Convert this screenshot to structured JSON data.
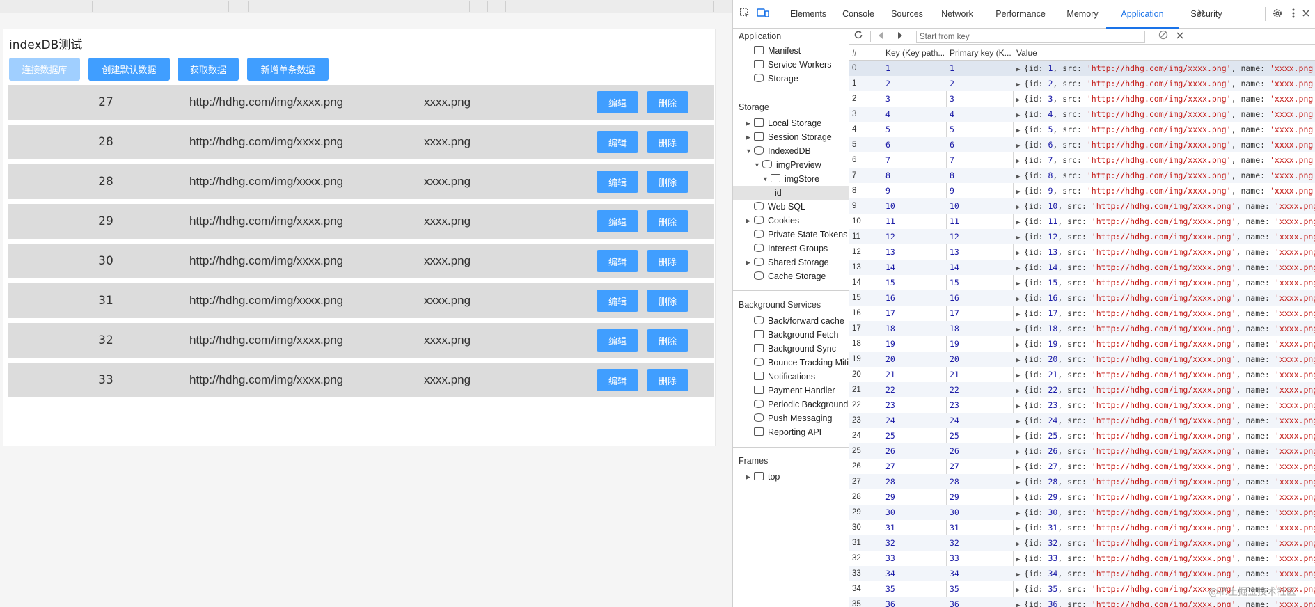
{
  "app": {
    "title": "indexDB测试",
    "buttons": {
      "connect": "连接数据库",
      "create_default": "创建默认数据",
      "get_data": "获取数据",
      "add_single": "新增单条数据"
    },
    "row_edit_label": "编辑",
    "row_delete_label": "删除",
    "rows": [
      {
        "id": "27",
        "src": "http://hdhg.com/img/xxxx.png",
        "name": "xxxx.png"
      },
      {
        "id": "28",
        "src": "http://hdhg.com/img/xxxx.png",
        "name": "xxxx.png"
      },
      {
        "id": "28",
        "src": "http://hdhg.com/img/xxxx.png",
        "name": "xxxx.png"
      },
      {
        "id": "29",
        "src": "http://hdhg.com/img/xxxx.png",
        "name": "xxxx.png"
      },
      {
        "id": "30",
        "src": "http://hdhg.com/img/xxxx.png",
        "name": "xxxx.png"
      },
      {
        "id": "31",
        "src": "http://hdhg.com/img/xxxx.png",
        "name": "xxxx.png"
      },
      {
        "id": "32",
        "src": "http://hdhg.com/img/xxxx.png",
        "name": "xxxx.png"
      },
      {
        "id": "33",
        "src": "http://hdhg.com/img/xxxx.png",
        "name": "xxxx.png"
      }
    ],
    "accent_color": "#409eff"
  },
  "devtools": {
    "tabs": [
      "Elements",
      "Console",
      "Sources",
      "Network",
      "Performance",
      "Memory",
      "Application",
      "Security"
    ],
    "active_tab": "Application",
    "more_tabs_icon": "chevron-double-right-icon",
    "sidebar": {
      "application_header": "Application",
      "application_items": [
        "Manifest",
        "Service Workers",
        "Storage"
      ],
      "storage_header": "Storage",
      "storage_items": [
        "Local Storage",
        "Session Storage",
        "IndexedDB",
        "imgPreview",
        "imgStore",
        "id",
        "Web SQL",
        "Cookies",
        "Private State Tokens",
        "Interest Groups",
        "Shared Storage",
        "Cache Storage"
      ],
      "background_header": "Background Services",
      "background_items": [
        "Back/forward cache",
        "Background Fetch",
        "Background Sync",
        "Bounce Tracking Mitig",
        "Notifications",
        "Payment Handler",
        "Periodic Background S",
        "Push Messaging",
        "Reporting API"
      ],
      "frames_header": "Frames",
      "frames_items": [
        "top"
      ]
    },
    "key_placeholder": "Start from key",
    "columns": [
      "#",
      "Key (Key path...",
      "Primary key (K...",
      "Value"
    ],
    "records": [
      {
        "idx": "0",
        "key": "1",
        "pk": "1",
        "val_id": "1",
        "val_src": "'http://hdhg.com/img/xxxx.png'",
        "val_name": "'xxxx.png'"
      },
      {
        "idx": "1",
        "key": "2",
        "pk": "2",
        "val_id": "2",
        "val_src": "'http://hdhg.com/img/xxxx.png'",
        "val_name": "'xxxx.png'"
      },
      {
        "idx": "2",
        "key": "3",
        "pk": "3",
        "val_id": "3",
        "val_src": "'http://hdhg.com/img/xxxx.png'",
        "val_name": "'xxxx.png'"
      },
      {
        "idx": "3",
        "key": "4",
        "pk": "4",
        "val_id": "4",
        "val_src": "'http://hdhg.com/img/xxxx.png'",
        "val_name": "'xxxx.png'"
      },
      {
        "idx": "4",
        "key": "5",
        "pk": "5",
        "val_id": "5",
        "val_src": "'http://hdhg.com/img/xxxx.png'",
        "val_name": "'xxxx.png'"
      },
      {
        "idx": "5",
        "key": "6",
        "pk": "6",
        "val_id": "6",
        "val_src": "'http://hdhg.com/img/xxxx.png'",
        "val_name": "'xxxx.png'"
      },
      {
        "idx": "6",
        "key": "7",
        "pk": "7",
        "val_id": "7",
        "val_src": "'http://hdhg.com/img/xxxx.png'",
        "val_name": "'xxxx.png'"
      },
      {
        "idx": "7",
        "key": "8",
        "pk": "8",
        "val_id": "8",
        "val_src": "'http://hdhg.com/img/xxxx.png'",
        "val_name": "'xxxx.png'"
      },
      {
        "idx": "8",
        "key": "9",
        "pk": "9",
        "val_id": "9",
        "val_src": "'http://hdhg.com/img/xxxx.png'",
        "val_name": "'xxxx.png'"
      },
      {
        "idx": "9",
        "key": "10",
        "pk": "10",
        "val_id": "10",
        "val_src": "'http://hdhg.com/img/xxxx.png'",
        "val_name": "'xxxx.png"
      },
      {
        "idx": "10",
        "key": "11",
        "pk": "11",
        "val_id": "11",
        "val_src": "'http://hdhg.com/img/xxxx.png'",
        "val_name": "'xxxx.png"
      },
      {
        "idx": "11",
        "key": "12",
        "pk": "12",
        "val_id": "12",
        "val_src": "'http://hdhg.com/img/xxxx.png'",
        "val_name": "'xxxx.png"
      },
      {
        "idx": "12",
        "key": "13",
        "pk": "13",
        "val_id": "13",
        "val_src": "'http://hdhg.com/img/xxxx.png'",
        "val_name": "'xxxx.png"
      },
      {
        "idx": "13",
        "key": "14",
        "pk": "14",
        "val_id": "14",
        "val_src": "'http://hdhg.com/img/xxxx.png'",
        "val_name": "'xxxx.png"
      },
      {
        "idx": "14",
        "key": "15",
        "pk": "15",
        "val_id": "15",
        "val_src": "'http://hdhg.com/img/xxxx.png'",
        "val_name": "'xxxx.png"
      },
      {
        "idx": "15",
        "key": "16",
        "pk": "16",
        "val_id": "16",
        "val_src": "'http://hdhg.com/img/xxxx.png'",
        "val_name": "'xxxx.png"
      },
      {
        "idx": "16",
        "key": "17",
        "pk": "17",
        "val_id": "17",
        "val_src": "'http://hdhg.com/img/xxxx.png'",
        "val_name": "'xxxx.png"
      },
      {
        "idx": "17",
        "key": "18",
        "pk": "18",
        "val_id": "18",
        "val_src": "'http://hdhg.com/img/xxxx.png'",
        "val_name": "'xxxx.png"
      },
      {
        "idx": "18",
        "key": "19",
        "pk": "19",
        "val_id": "19",
        "val_src": "'http://hdhg.com/img/xxxx.png'",
        "val_name": "'xxxx.png"
      },
      {
        "idx": "19",
        "key": "20",
        "pk": "20",
        "val_id": "20",
        "val_src": "'http://hdhg.com/img/xxxx.png'",
        "val_name": "'xxxx.png"
      },
      {
        "idx": "20",
        "key": "21",
        "pk": "21",
        "val_id": "21",
        "val_src": "'http://hdhg.com/img/xxxx.png'",
        "val_name": "'xxxx.png"
      },
      {
        "idx": "21",
        "key": "22",
        "pk": "22",
        "val_id": "22",
        "val_src": "'http://hdhg.com/img/xxxx.png'",
        "val_name": "'xxxx.png"
      },
      {
        "idx": "22",
        "key": "23",
        "pk": "23",
        "val_id": "23",
        "val_src": "'http://hdhg.com/img/xxxx.png'",
        "val_name": "'xxxx.png"
      },
      {
        "idx": "23",
        "key": "24",
        "pk": "24",
        "val_id": "24",
        "val_src": "'http://hdhg.com/img/xxxx.png'",
        "val_name": "'xxxx.png"
      },
      {
        "idx": "24",
        "key": "25",
        "pk": "25",
        "val_id": "25",
        "val_src": "'http://hdhg.com/img/xxxx.png'",
        "val_name": "'xxxx.png"
      },
      {
        "idx": "25",
        "key": "26",
        "pk": "26",
        "val_id": "26",
        "val_src": "'http://hdhg.com/img/xxxx.png'",
        "val_name": "'xxxx.png"
      },
      {
        "idx": "26",
        "key": "27",
        "pk": "27",
        "val_id": "27",
        "val_src": "'http://hdhg.com/img/xxxx.png'",
        "val_name": "'xxxx.png"
      },
      {
        "idx": "27",
        "key": "28",
        "pk": "28",
        "val_id": "28",
        "val_src": "'http://hdhg.com/img/xxxx.png'",
        "val_name": "'xxxx.png"
      },
      {
        "idx": "28",
        "key": "29",
        "pk": "29",
        "val_id": "29",
        "val_src": "'http://hdhg.com/img/xxxx.png'",
        "val_name": "'xxxx.png"
      },
      {
        "idx": "29",
        "key": "30",
        "pk": "30",
        "val_id": "30",
        "val_src": "'http://hdhg.com/img/xxxx.png'",
        "val_name": "'xxxx.png"
      },
      {
        "idx": "30",
        "key": "31",
        "pk": "31",
        "val_id": "31",
        "val_src": "'http://hdhg.com/img/xxxx.png'",
        "val_name": "'xxxx.png"
      },
      {
        "idx": "31",
        "key": "32",
        "pk": "32",
        "val_id": "32",
        "val_src": "'http://hdhg.com/img/xxxx.png'",
        "val_name": "'xxxx.png"
      },
      {
        "idx": "32",
        "key": "33",
        "pk": "33",
        "val_id": "33",
        "val_src": "'http://hdhg.com/img/xxxx.png'",
        "val_name": "'xxxx.png"
      },
      {
        "idx": "33",
        "key": "34",
        "pk": "34",
        "val_id": "34",
        "val_src": "'http://hdhg.com/img/xxxx.png'",
        "val_name": "'xxxx.png"
      },
      {
        "idx": "34",
        "key": "35",
        "pk": "35",
        "val_id": "35",
        "val_src": "'http://hdhg.com/img/xxxx.png'",
        "val_name": "'xxxx.png"
      },
      {
        "idx": "35",
        "key": "36",
        "pk": "36",
        "val_id": "36",
        "val_src": "'http://hdhg.com/img/xxxx.png'",
        "val_name": "'xxxx.png"
      }
    ]
  },
  "watermark": "@稀土掘金技术社区"
}
